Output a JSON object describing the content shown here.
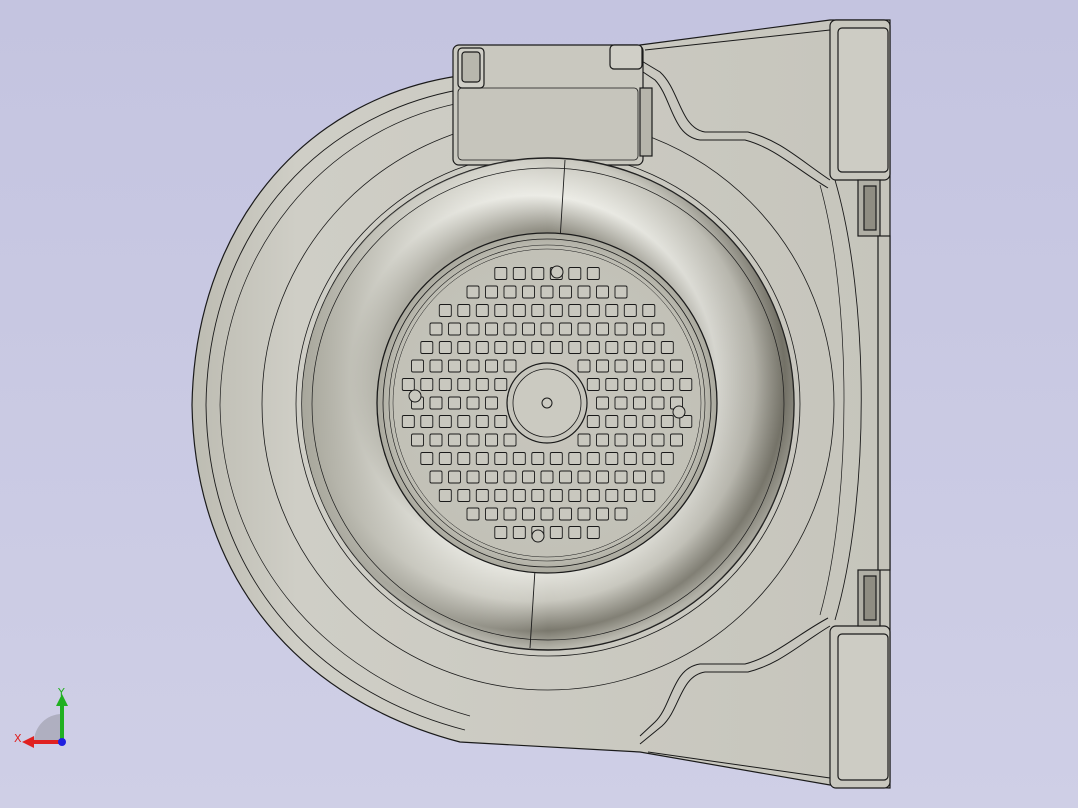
{
  "viewport": {
    "background_top": "#c4c4e0",
    "background_bottom": "#cfcfe6",
    "model_fill": "#c7c6bd",
    "model_edge": "#1a1a1a",
    "shade_dark": "#8f8d82",
    "shade_light": "#f2f2ec"
  },
  "triad": {
    "x_label": "X",
    "y_label": "Y",
    "x_color": "#e02020",
    "y_color": "#20b020",
    "z_color": "#2020e0"
  },
  "grille": {
    "hole_rows": 14,
    "mount_holes": 5
  }
}
